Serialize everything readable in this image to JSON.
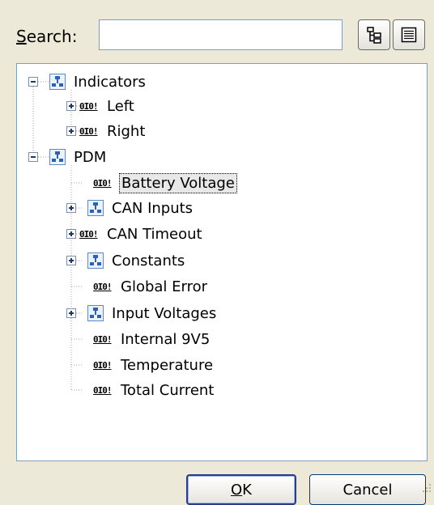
{
  "search": {
    "label_first": "S",
    "label_rest": "earch:",
    "value": ""
  },
  "toolbar": {
    "tree_view_icon": "tree-view-icon",
    "list_view_icon": "list-view-icon"
  },
  "tree": {
    "indicators": {
      "label": "Indicators",
      "icon": "group-icon",
      "expanded": true
    },
    "left": {
      "label": "Left",
      "icon": "signal-icon",
      "signal_text": "0I0!"
    },
    "right": {
      "label": "Right",
      "icon": "signal-icon",
      "signal_text": "0I0!"
    },
    "pdm": {
      "label": "PDM",
      "icon": "group-icon",
      "expanded": true
    },
    "battery_voltage": {
      "label": "Battery Voltage",
      "icon": "signal-icon",
      "signal_text": "0I0!",
      "selected": true
    },
    "can_inputs": {
      "label": "CAN Inputs",
      "icon": "group-icon"
    },
    "can_timeout": {
      "label": "CAN Timeout",
      "icon": "signal-icon",
      "signal_text": "0I0!"
    },
    "constants": {
      "label": "Constants",
      "icon": "group-icon"
    },
    "global_error": {
      "label": "Global Error",
      "icon": "signal-icon",
      "signal_text": "0I0!"
    },
    "input_voltages": {
      "label": "Input Voltages",
      "icon": "group-icon"
    },
    "internal_9v5": {
      "label": "Internal 9V5",
      "icon": "signal-icon",
      "signal_text": "0I0!"
    },
    "temperature": {
      "label": "Temperature",
      "icon": "signal-icon",
      "signal_text": "0I0!"
    },
    "total_current": {
      "label": "Total Current",
      "icon": "signal-icon",
      "signal_text": "0I0!"
    }
  },
  "buttons": {
    "ok_first": "O",
    "ok_rest": "K",
    "cancel": "Cancel"
  },
  "colors": {
    "dialog_bg": "#ece9d8",
    "border": "#7f9db9",
    "selection_bg": "#e8e8e8"
  }
}
